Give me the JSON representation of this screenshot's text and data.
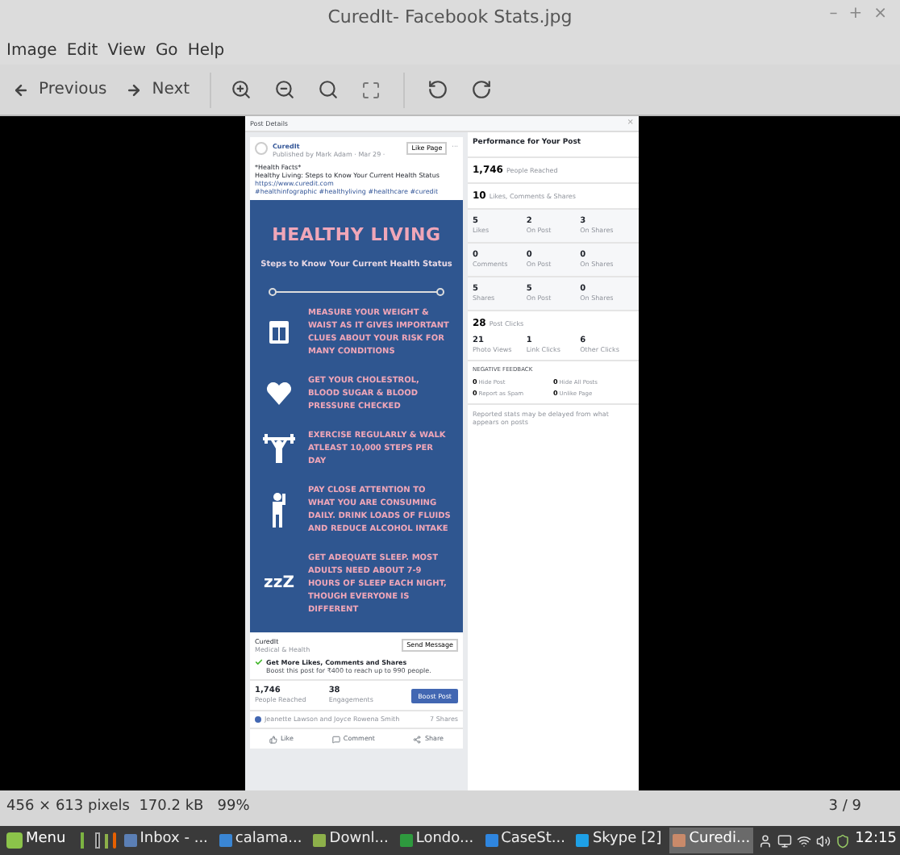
{
  "window": {
    "title": "CuredIt- Facebook Stats.jpg",
    "controls": [
      "–",
      "+",
      "×"
    ]
  },
  "menu": [
    "Image",
    "Edit",
    "View",
    "Go",
    "Help"
  ],
  "toolbar": {
    "previous": "Previous",
    "next": "Next"
  },
  "image": {
    "header": "Post Details",
    "close": "×",
    "post": {
      "page": "CuredIt",
      "byline": "Published by Mark Adam · Mar 29 ·",
      "like_page": "Like Page",
      "more": "···",
      "lines": [
        "*Health Facts*",
        "Healthy Living: Steps to Know Your Current Health Status"
      ],
      "link": "https://www.curedit.com",
      "tags": "#healthinfographic #healthyliving #healthcare #curedit"
    },
    "infographic": {
      "title": "HEALTHY LIVING",
      "subtitle": "Steps to Know Your Current Health Status",
      "items": [
        {
          "kind": "scale",
          "text": "MEASURE YOUR WEIGHT & WAIST AS IT GIVES IMPORTANT CLUES ABOUT YOUR RISK FOR MANY CONDITIONS"
        },
        {
          "kind": "heart",
          "text": "GET YOUR CHOLESTROL, BLOOD SUGAR & BLOOD PRESSURE CHECKED"
        },
        {
          "kind": "lifter",
          "text": "EXERCISE REGULARLY & WALK ATLEAST 10,000 STEPS PER DAY"
        },
        {
          "kind": "drinker",
          "text": "PAY CLOSE ATTENTION TO WHAT YOU ARE CONSUMING DAILY. DRINK LOADS OF FLUIDS AND REDUCE ALCOHOL INTAKE"
        },
        {
          "kind": "sleep",
          "glyph": "zzZ",
          "text": "GET ADEQUATE SLEEP. MOST ADULTS NEED ABOUT 7-9 HOURS OF SLEEP EACH NIGHT, THOUGH EVERYONE IS DIFFERENT"
        }
      ]
    },
    "footer": {
      "page": "CuredIt",
      "category": "Medical & Health",
      "send": "Send Message",
      "boost_title": "Get More Likes, Comments and Shares",
      "boost_text": "Boost this post for ₹400 to reach up to 990 people.",
      "stats": [
        {
          "value": "1,746",
          "label": "People Reached"
        },
        {
          "value": "38",
          "label": "Engagements"
        }
      ],
      "boost_button": "Boost Post",
      "reactions": "Jeanette Lawson and Joyce Rowena Smith",
      "shares": "7 Shares",
      "actions": [
        "Like",
        "Comment",
        "Share"
      ]
    },
    "performance": {
      "title": "Performance for Your Post",
      "reached": {
        "value": "1,746",
        "label": "People Reached"
      },
      "engagement": {
        "value": "10",
        "label": "Likes, Comments & Shares"
      },
      "grid": [
        [
          {
            "value": "5",
            "label": "Likes"
          },
          {
            "value": "2",
            "label": "On Post"
          },
          {
            "value": "3",
            "label": "On Shares"
          }
        ],
        [
          {
            "value": "0",
            "label": "Comments"
          },
          {
            "value": "0",
            "label": "On Post"
          },
          {
            "value": "0",
            "label": "On Shares"
          }
        ],
        [
          {
            "value": "5",
            "label": "Shares"
          },
          {
            "value": "5",
            "label": "On Post"
          },
          {
            "value": "0",
            "label": "On Shares"
          }
        ]
      ],
      "clicks": {
        "value": "28",
        "label": "Post Clicks"
      },
      "click_grid": [
        {
          "value": "21",
          "label": "Photo Views"
        },
        {
          "value": "1",
          "label": "Link Clicks"
        },
        {
          "value": "6",
          "label": "Other Clicks"
        }
      ],
      "negative_title": "NEGATIVE FEEDBACK",
      "negative": [
        {
          "value": "0",
          "label": "Hide Post"
        },
        {
          "value": "0",
          "label": "Hide All Posts"
        },
        {
          "value": "0",
          "label": "Report as Spam"
        },
        {
          "value": "0",
          "label": "Unlike Page"
        }
      ],
      "note": "Reported stats may be delayed from what appears on posts"
    }
  },
  "status_bar": {
    "info": "456 × 613 pixels  170.2 kB   99%",
    "position": "3 / 9"
  },
  "taskbar": {
    "menu": "Menu",
    "tasks": [
      {
        "label": "Inbox - ...",
        "selected": false,
        "color": "#5b7fb5"
      },
      {
        "label": "calama...",
        "selected": false,
        "color": "#3a86d4"
      },
      {
        "label": "Downl...",
        "selected": false,
        "color": "#8db04a"
      },
      {
        "label": "Londo...",
        "selected": false,
        "color": "#2e9a3e"
      },
      {
        "label": "CaseSt...",
        "selected": false,
        "color": "#2f86e0"
      },
      {
        "label": "Skype [2]",
        "selected": false,
        "color": "#1ea0e6"
      },
      {
        "label": "Curedi...",
        "selected": true,
        "color": "#c98a6a"
      }
    ],
    "clock": "12:15"
  }
}
